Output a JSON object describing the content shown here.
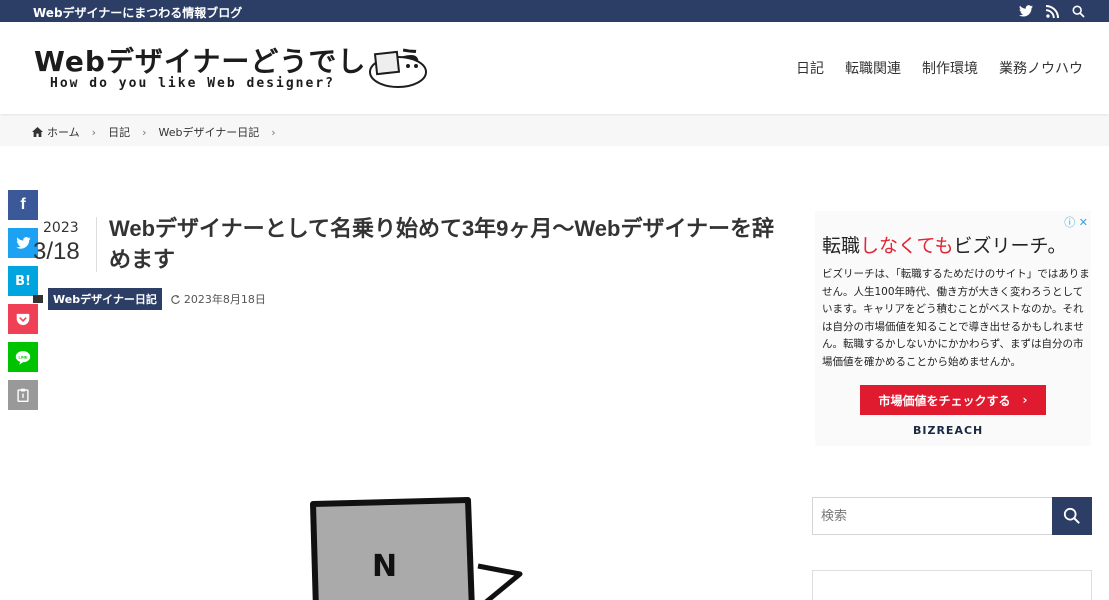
{
  "topbar": {
    "tagline": "Webデザイナーにまつわる情報ブログ",
    "icons": [
      "twitter-icon",
      "rss-icon",
      "search-icon"
    ]
  },
  "header": {
    "logo_title": "Webデザイナーどうでしょう",
    "logo_subtitle": "How do you like Web designer?",
    "nav": [
      "日記",
      "転職関連",
      "制作環境",
      "業務ノウハウ"
    ]
  },
  "breadcrumb": {
    "home": "ホーム",
    "items": [
      "日記",
      "Webデザイナー日記"
    ]
  },
  "share": {
    "buttons": [
      {
        "name": "facebook",
        "label": "f",
        "color": "#3b5998"
      },
      {
        "name": "twitter",
        "label": "",
        "color": "#1da1f2"
      },
      {
        "name": "hatena",
        "label": "B!",
        "color": "#00a4de"
      },
      {
        "name": "pocket",
        "label": "",
        "color": "#ef4056"
      },
      {
        "name": "line",
        "label": "",
        "color": "#00c300"
      },
      {
        "name": "copy",
        "label": "",
        "color": "#999999"
      }
    ]
  },
  "article": {
    "date_year": "2023",
    "date_md": "3/18",
    "title": "Webデザイナーとして名乗り始めて3年9ヶ月〜Webデザイナーを辞めます",
    "category": "Webデザイナー日記",
    "updated": "2023年8月18日"
  },
  "ad": {
    "headline_a": "転職",
    "headline_b": "しなくても",
    "headline_c": "ビズリーチ。",
    "body": "ビズリーチは、「転職するためだけのサイト」ではありません。人生100年時代、働き方が大きく変わろうとしています。キャリアをどう積むことがベストなのか。それは自分の市場価値を知ることで導き出せるかもしれません。転職するかしないかにかかわらず、まずは自分の市場価値を確かめることから始めませんか。",
    "button": "市場価値をチェックする",
    "brand": "BIZREACH",
    "accent": "#e01a2f"
  },
  "sidebar": {
    "search_placeholder": "検索"
  },
  "colors": {
    "navy": "#2c3e66"
  }
}
